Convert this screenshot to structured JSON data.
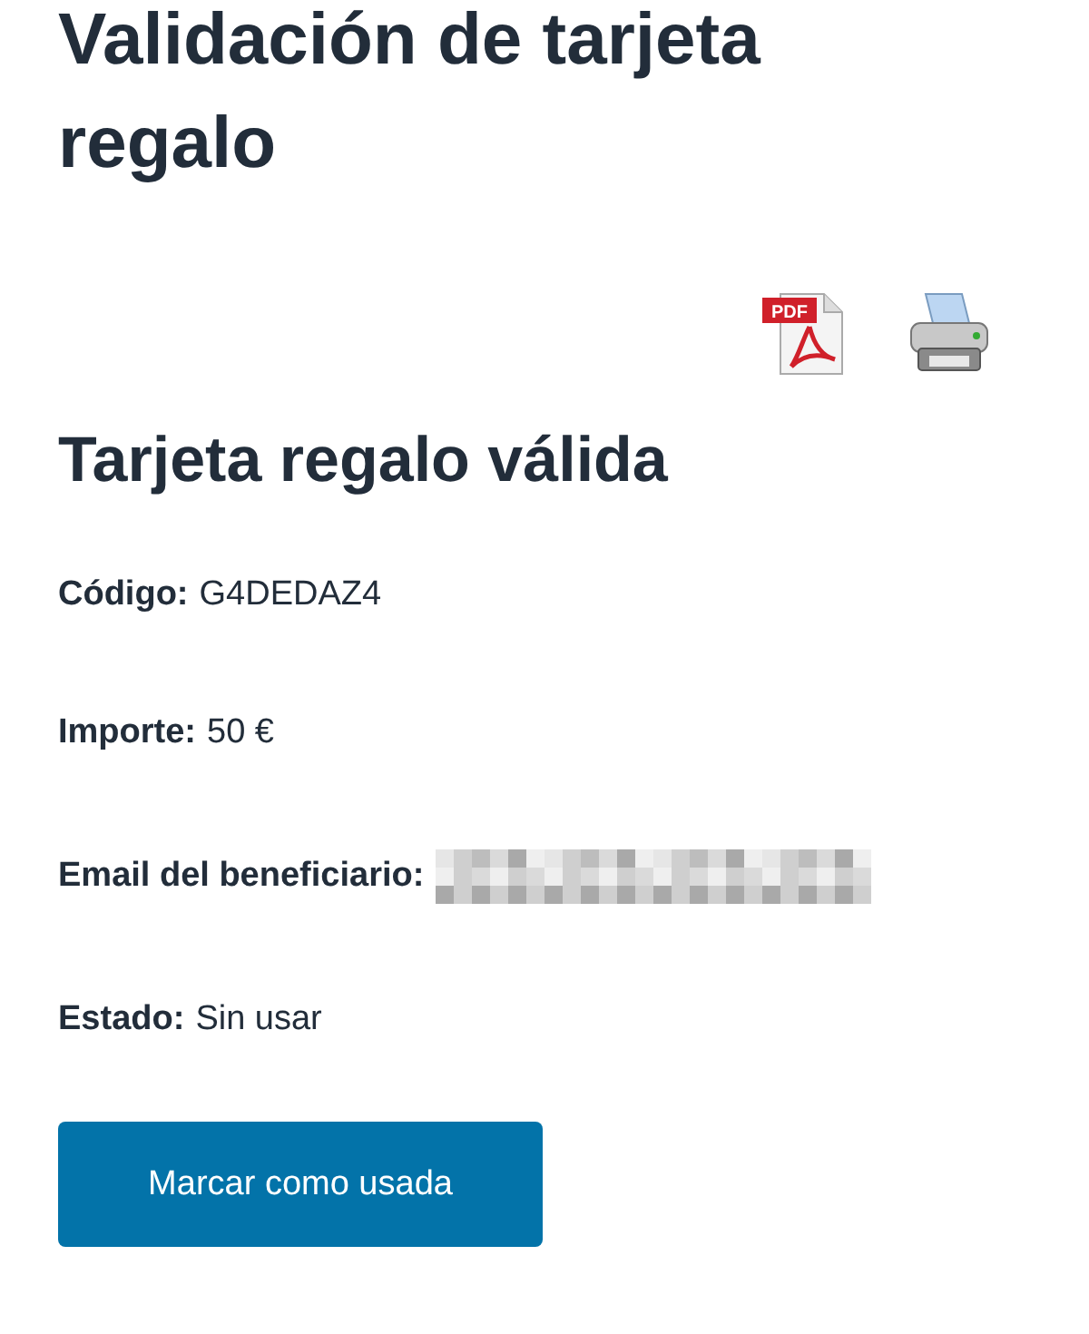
{
  "title": "Validación de tarjeta regalo",
  "icons": [
    {
      "kind": "pdf",
      "label": "PDF"
    },
    {
      "kind": "print"
    }
  ],
  "status_heading": "Tarjeta regalo válida",
  "fields": [
    {
      "label": "Código:",
      "value": "G4DEDAZ4"
    },
    {
      "label": "Importe:",
      "value": "50 €"
    },
    {
      "label": "Email del beneficiario:",
      "kind": "redacted"
    },
    {
      "label": "Estado:",
      "value": "Sin usar"
    }
  ],
  "button": "Marcar como usada"
}
